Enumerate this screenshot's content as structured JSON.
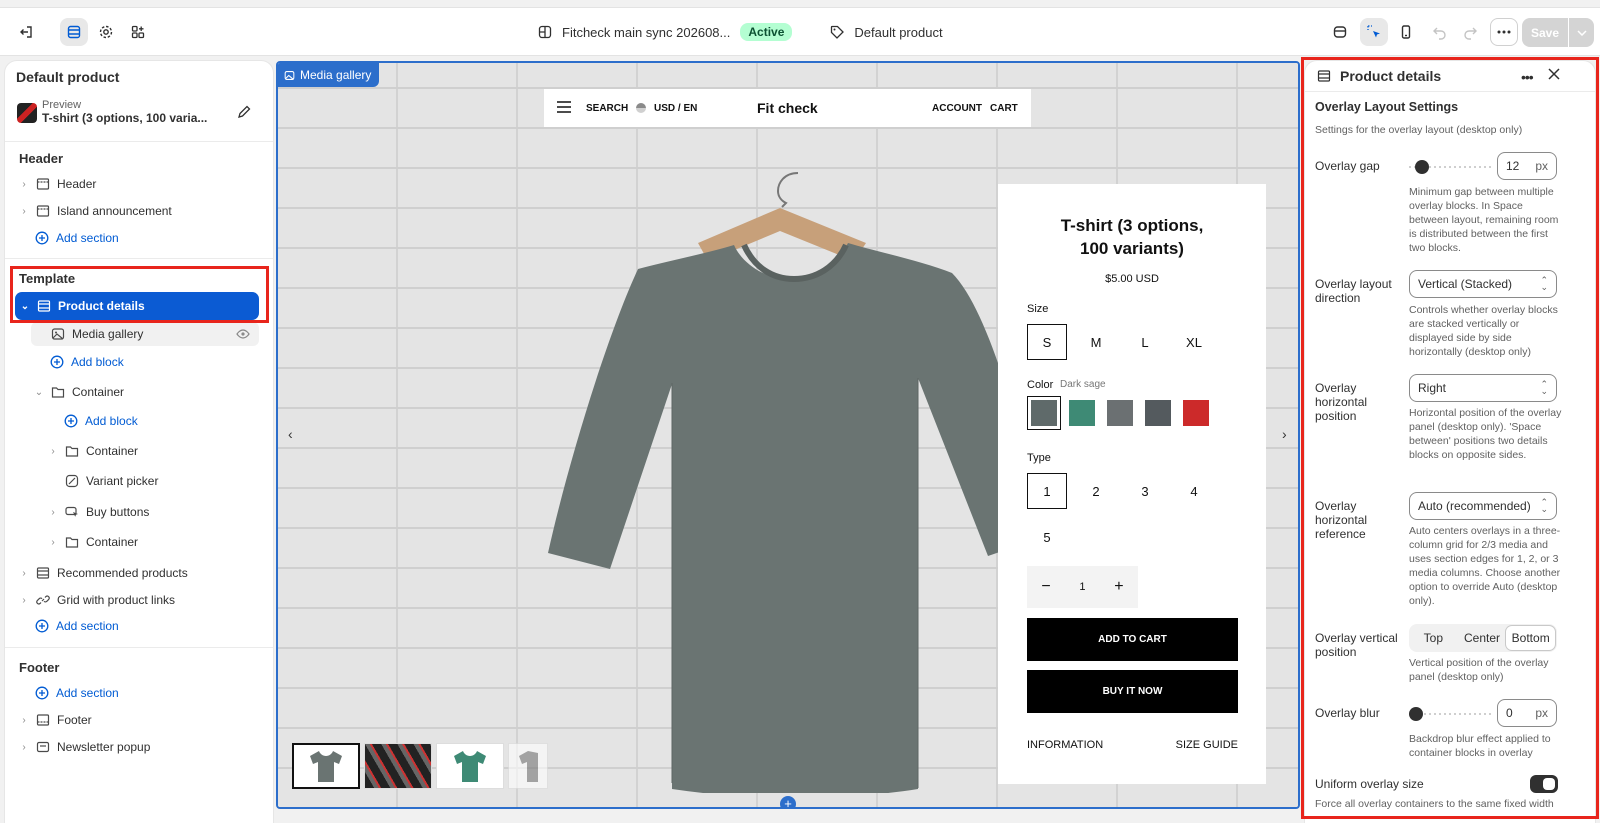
{
  "topbar": {
    "theme_name": "Fitcheck main sync 202608...",
    "status": "Active",
    "template_name": "Default product",
    "save_label": "Save"
  },
  "left_panel": {
    "title": "Default product",
    "preview_label": "Preview",
    "preview_product": "T-shirt (3 options, 100 varia...",
    "header_section": "Header",
    "header_items": [
      "Header",
      "Island announcement"
    ],
    "add_section": "Add section",
    "template_section": "Template",
    "selected_item": "Product details",
    "media_gallery": "Media gallery",
    "add_block": "Add block",
    "container": "Container",
    "variant_picker": "Variant picker",
    "buy_buttons": "Buy buttons",
    "recommended": "Recommended products",
    "grid_links": "Grid with product links",
    "footer_section": "Footer",
    "footer_item": "Footer",
    "newsletter": "Newsletter popup"
  },
  "canvas": {
    "block_tag": "Media gallery",
    "nav": {
      "search": "SEARCH",
      "currency": "USD / EN",
      "logo": "Fit check",
      "account": "ACCOUNT",
      "cart": "CART"
    },
    "product": {
      "title": "T-shirt (3 options, 100 variants)",
      "price": "$5.00 USD",
      "size_label": "Size",
      "sizes": [
        "S",
        "M",
        "L",
        "XL"
      ],
      "selected_size": "S",
      "color_label": "Color",
      "color_value": "Dark sage",
      "type_label": "Type",
      "types": [
        "1",
        "2",
        "3",
        "4",
        "5"
      ],
      "quantity": "1",
      "add_to_cart": "ADD TO CART",
      "buy_now": "BUY IT NOW",
      "information": "INFORMATION",
      "size_guide": "SIZE GUIDE"
    }
  },
  "right_panel": {
    "title": "Product details",
    "heading": "Overlay Layout Settings",
    "subheading": "Settings for the overlay layout (desktop only)",
    "overlay_gap": {
      "label": "Overlay gap",
      "value": "12",
      "unit": "px",
      "help": "Minimum gap between multiple overlay blocks. In Space between layout, remaining room is distributed between the first two blocks."
    },
    "layout_direction": {
      "label": "Overlay layout direction",
      "value": "Vertical (Stacked)",
      "help": "Controls whether overlay blocks are stacked vertically or displayed side by side horizontally (desktop only)"
    },
    "horizontal_position": {
      "label": "Overlay horizontal position",
      "value": "Right",
      "help": "Horizontal position of the overlay panel (desktop only). 'Space between' positions two details blocks on opposite sides."
    },
    "horizontal_reference": {
      "label": "Overlay horizontal reference",
      "value": "Auto (recommended)",
      "help": "Auto centers overlays in a three-column grid for 2/3 media and uses section edges for 1, 2, or 3 media columns. Choose another option to override Auto (desktop only)."
    },
    "vertical_position": {
      "label": "Overlay vertical position",
      "options": [
        "Top",
        "Center",
        "Bottom"
      ],
      "selected": "Bottom",
      "help": "Vertical position of the overlay panel (desktop only)"
    },
    "overlay_blur": {
      "label": "Overlay blur",
      "value": "0",
      "unit": "px",
      "help": "Backdrop blur effect applied to container blocks in overlay"
    },
    "uniform_size": {
      "label": "Uniform overlay size",
      "enabled": true,
      "help": "Force all overlay containers to the same fixed width"
    }
  },
  "colors": {
    "accent": "#005bd3",
    "selected_row": "#0b5bd3",
    "highlight": "#e8251c",
    "canvas_border": "#2c6ecb"
  }
}
